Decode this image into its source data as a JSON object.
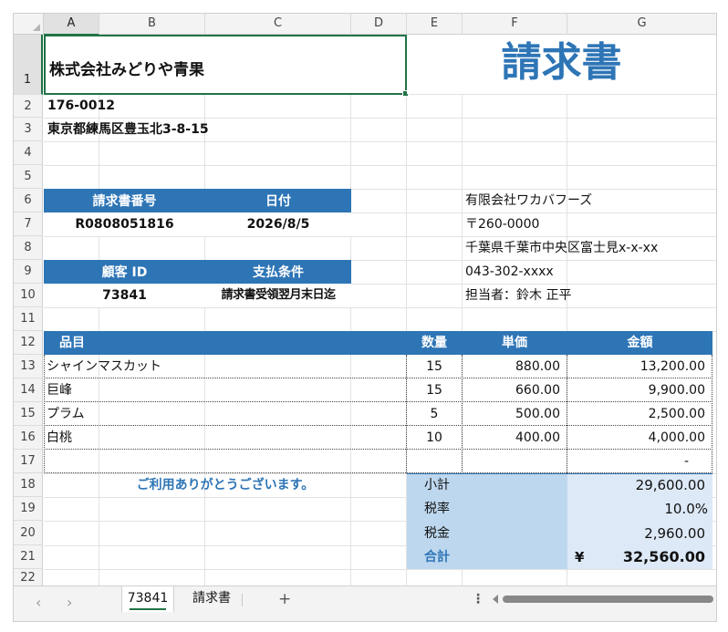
{
  "columns": [
    "A",
    "B",
    "C",
    "D",
    "E",
    "F",
    "G"
  ],
  "rows": [
    "1",
    "2",
    "3",
    "4",
    "5",
    "6",
    "7",
    "8",
    "9",
    "10",
    "11",
    "12",
    "13",
    "14",
    "15",
    "16",
    "17",
    "18",
    "19",
    "20",
    "21",
    "22"
  ],
  "seller": {
    "name": "株式会社みどりや青果",
    "postal": "176-0012",
    "address": "東京都練馬区豊玉北3-8-15"
  },
  "title": "請求書",
  "invoice_headers": {
    "number": "請求書番号",
    "date": "日付"
  },
  "invoice_values": {
    "number": "R0808051816",
    "date": "2026/8/5"
  },
  "customer_headers": {
    "id": "顧客 ID",
    "terms": "支払条件"
  },
  "customer_values": {
    "id": "73841",
    "terms": "請求書受領翌月末日迄"
  },
  "client": {
    "name": "有限会社ワカバフーズ",
    "postal": "〒260-0000",
    "address": "千葉県千葉市中央区富士見x-x-xx",
    "phone": "043-302-xxxx",
    "contact": "担当者：鈴木 正平"
  },
  "table_headers": {
    "item": "品目",
    "qty": "数量",
    "unit": "単価",
    "amount": "金額"
  },
  "items": [
    {
      "name": "シャインマスカット",
      "qty": "15",
      "unit": "880.00",
      "amount": "13,200.00"
    },
    {
      "name": "巨峰",
      "qty": "15",
      "unit": "660.00",
      "amount": "9,900.00"
    },
    {
      "name": "プラム",
      "qty": "5",
      "unit": "500.00",
      "amount": "2,500.00"
    },
    {
      "name": "白桃",
      "qty": "10",
      "unit": "400.00",
      "amount": "4,000.00"
    },
    {
      "name": "",
      "qty": "",
      "unit": "",
      "amount": "-"
    }
  ],
  "thanks": "ご利用ありがとうございます。",
  "totals": {
    "subtotal_label": "小計",
    "subtotal": "29,600.00",
    "taxrate_label": "税率",
    "taxrate": "10.0%",
    "tax_label": "税金",
    "tax": "2,960.00",
    "total_label": "合計",
    "currency": "¥",
    "total": "32,560.00"
  },
  "sheet_tabs": {
    "active": "73841",
    "other": "請求書",
    "add": "+"
  },
  "colors": {
    "accent": "#2e75b6",
    "light": "#dde9f7",
    "mid": "#bdd7ee",
    "selection": "#217346"
  }
}
